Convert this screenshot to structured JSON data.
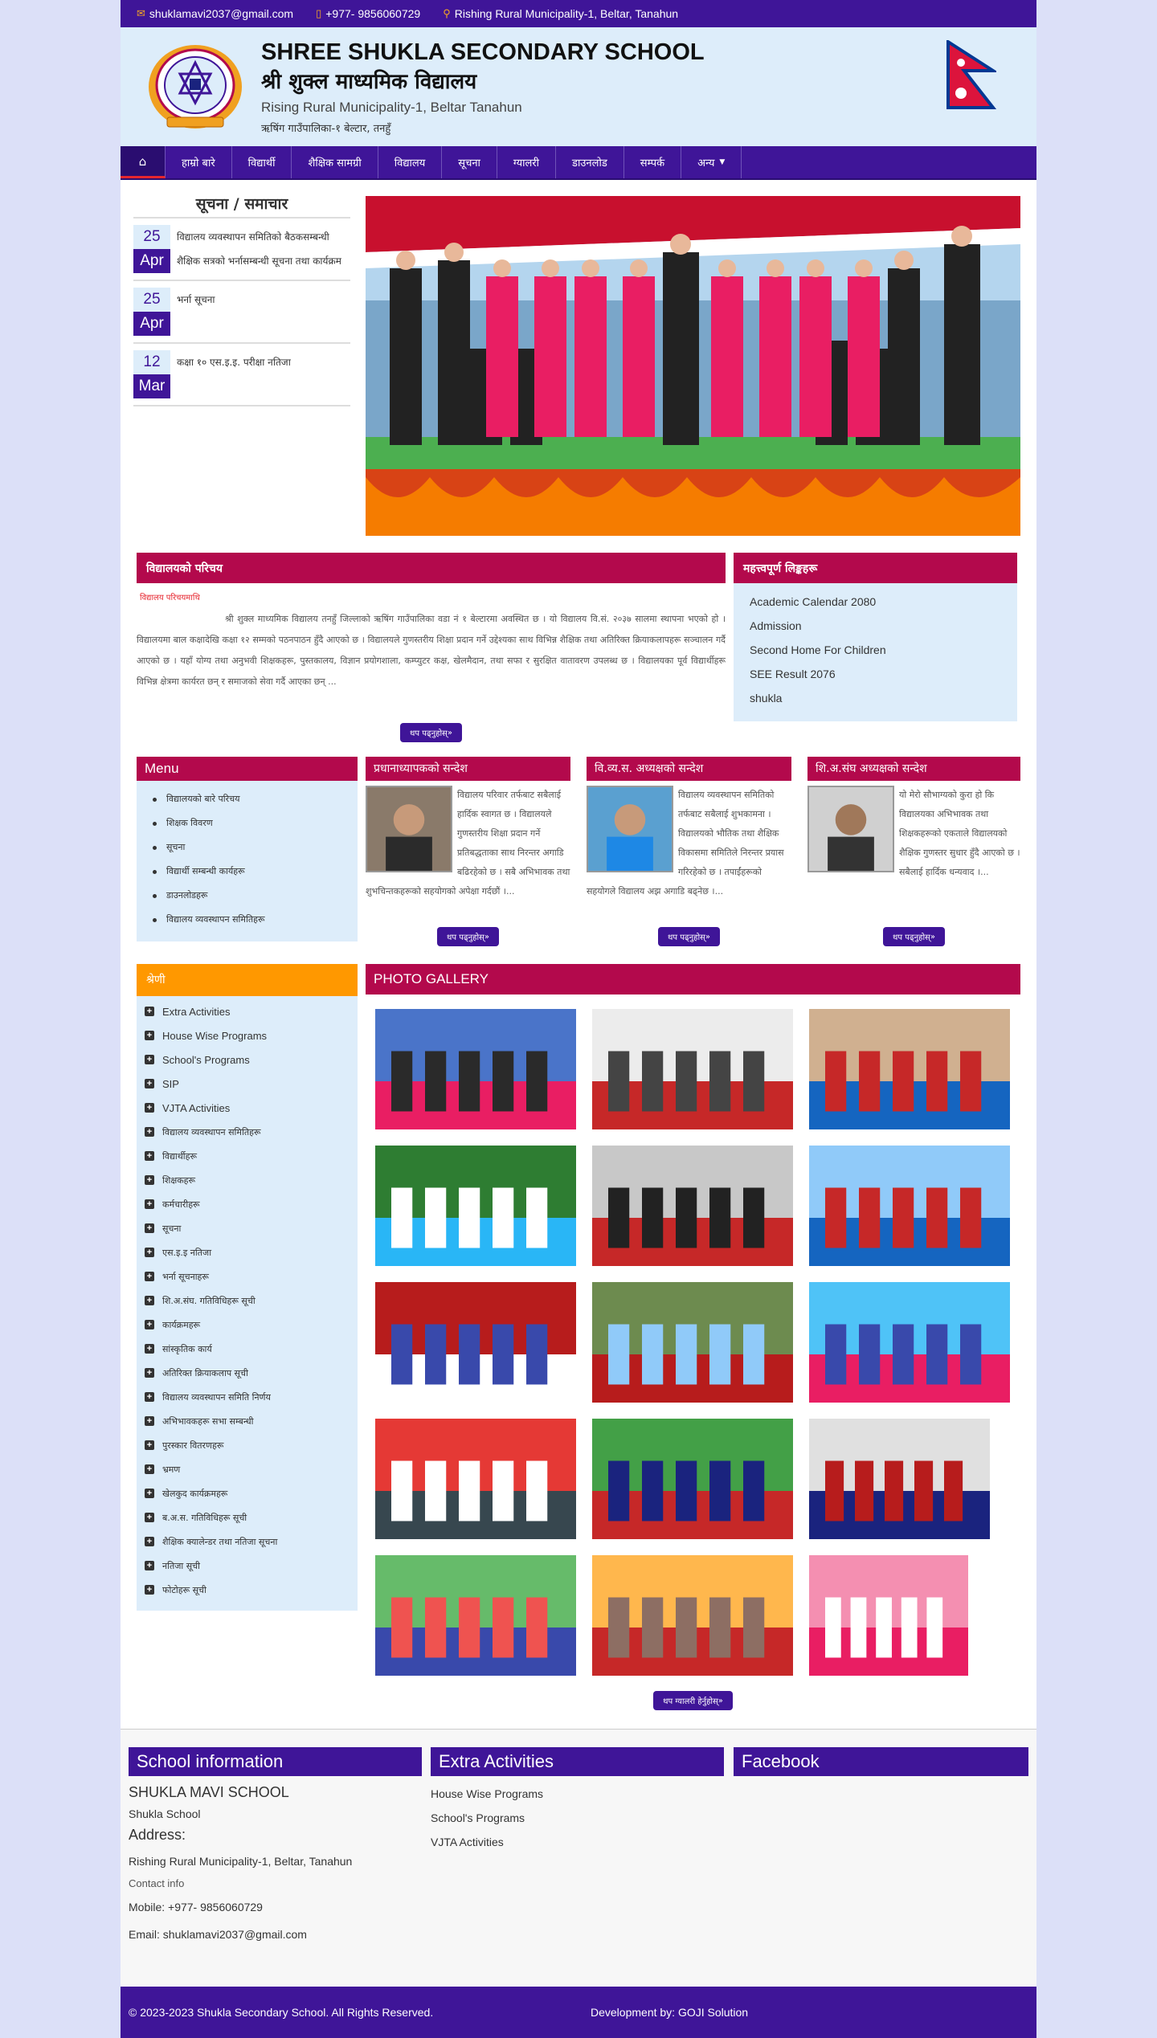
{
  "topbar": {
    "email": "shuklamavi2037@gmail.com",
    "phone": "+977- 9856060729",
    "address": "Rishing Rural Municipality-1, Beltar, Tanahun"
  },
  "header": {
    "title_en": "SHREE SHUKLA SECONDARY SCHOOL",
    "title_np": "श्री शुक्ल माध्यमिक विद्यालय",
    "address_en": "Rising Rural Municipality-1, Beltar Tanahun",
    "address_np": "ऋषिंग गाउँपालिका-१ बेल्टार, तनहुँ"
  },
  "nav": {
    "items": [
      "हाम्रो बारे",
      "विद्यार्थी",
      "शैक्षिक सामग्री",
      "विद्यालय",
      "सूचना",
      "ग्यालरी",
      "डाउनलोड",
      "सम्पर्क",
      "अन्य"
    ]
  },
  "news": {
    "title": "सूचना / समाचार",
    "items": [
      {
        "day": "25",
        "month": "Apr",
        "lines": [
          "विद्यालय व्यवस्थापन समितिको बैठकसम्बन्धी",
          "शैक्षिक सत्रको भर्नासम्बन्धी सूचना तथा कार्यक्रम"
        ]
      },
      {
        "day": "25",
        "month": "Apr",
        "lines": [
          "भर्ना सूचना"
        ]
      },
      {
        "day": "12",
        "month": "Mar",
        "lines": [
          "कक्षा १० एस.इ.इ. परीक्षा नतिजा"
        ]
      }
    ]
  },
  "intro": {
    "title": "विद्यालयको परिचय",
    "subtitle": "विद्यालय परिचयमाथि",
    "para": "श्री शुक्ल माध्यमिक विद्यालय तनहुँ जिल्लाको ऋषिंग गाउँपालिका वडा नं १ बेल्टारमा अवस्थित छ । यो विद्यालय वि.सं. २०३७ सालमा स्थापना भएको हो । विद्यालयमा बाल कक्षादेखि कक्षा १२ सम्मको पठनपाठन हुँदै आएको छ । विद्यालयले गुणस्तरीय शिक्षा प्रदान गर्ने उद्देश्यका साथ विभिन्न शैक्षिक तथा अतिरिक्त क्रियाकलापहरू सञ्चालन गर्दै आएको छ । यहाँ योग्य तथा अनुभवी शिक्षकहरू, पुस्तकालय, विज्ञान प्रयोगशाला, कम्प्युटर कक्ष, खेलमैदान, तथा सफा र सुरक्षित वातावरण उपलब्ध छ । विद्यालयका पूर्व विद्यार्थीहरू विभिन्न क्षेत्रमा कार्यरत छन् र समाजको सेवा गर्दै आएका छन् ...",
    "more": "थप पढ्नुहोस्"
  },
  "important": {
    "title": "महत्त्वपूर्ण लिङ्कहरू",
    "links": [
      "Academic Calendar 2080",
      "Admission",
      "Second Home For Children",
      "SEE Result 2076",
      "shukla"
    ]
  },
  "menu": {
    "title": "Menu",
    "items": [
      "विद्यालयको बारे परिचय",
      "शिक्षक विवरण",
      "सूचना",
      "विद्यार्थी सम्बन्धी कार्यहरू",
      "डाउनलोडहरू",
      "विद्यालय व्यवस्थापन समितिहरू"
    ]
  },
  "cards": [
    {
      "title": "प्रधानाध्यापकको सन्देश",
      "text": "विद्यालय परिवार तर्फबाट सबैलाई हार्दिक स्वागत छ । विद्यालयले गुणस्तरीय शिक्षा प्रदान गर्ने प्रतिबद्धताका साथ निरन्तर अगाडि बढिरहेको छ । सबै अभिभावक तथा शुभचिन्तकहरूको सहयोगको अपेक्षा गर्दछौं ।...",
      "more": "थप पढ्नुहोस्"
    },
    {
      "title": "वि.व्य.स. अध्यक्षको सन्देश",
      "text": "विद्यालय व्यवस्थापन समितिको तर्फबाट सबैलाई शुभकामना । विद्यालयको भौतिक तथा शैक्षिक विकासमा समितिले निरन्तर प्रयास गरिरहेको छ । तपाईंहरूको सहयोगले विद्यालय अझ अगाडि बढ्नेछ ।...",
      "more": "थप पढ्नुहोस्"
    },
    {
      "title": "शि.अ.संघ अध्यक्षको सन्देश",
      "text": "यो मेरो सौभाग्यको कुरा हो कि विद्यालयका अभिभावक तथा शिक्षकहरूको एकताले विद्यालयको शैक्षिक गुणस्तर सुधार हुँदै आएको छ । सबैलाई हार्दिक धन्यवाद ।...",
      "more": "थप पढ्नुहोस्"
    }
  ],
  "categories": {
    "title": "श्रेणी",
    "items": [
      "Extra Activities",
      "House Wise Programs",
      "School's Programs",
      "SIP",
      "VJTA Activities",
      "विद्यालय व्यवस्थापन समितिहरू",
      "विद्यार्थीहरू",
      "शिक्षकहरू",
      "कर्मचारीहरू",
      "सूचना",
      "एस.इ.इ नतिजा",
      "भर्ना सूचनाहरू",
      "शि.अ.संघ. गतिविधिहरू सूची",
      "कार्यक्रमहरू",
      "सांस्कृतिक कार्य",
      "अतिरिक्त क्रियाकलाप सूची",
      "विद्यालय व्यवस्थापन समिति निर्णय",
      "अभिभावकहरू सभा सम्बन्धी",
      "पुरस्कार वितरणहरू",
      "भ्रमण",
      "खेलकुद कार्यक्रमहरू",
      "ब.अ.स. गतिविधिहरू सूची",
      "शैक्षिक क्यालेन्डर तथा नतिजा सूचना",
      "नतिजा सूची",
      "फोटोहरू सूची"
    ]
  },
  "gallery": {
    "title": "PHOTO GALLERY",
    "more": "थप ग्यालरी हेर्नुहोस्"
  },
  "footer": {
    "info_title": "School information",
    "school_name": "SHUKLA MAVI SCHOOL",
    "school_name2": "Shukla School",
    "address_label": "Address:",
    "address": "Rishing Rural Municipality-1, Beltar, Tanahun",
    "contact_label": "Contact info",
    "mobile": "Mobile: +977- 9856060729",
    "email": "Email: shuklamavi2037@gmail.com",
    "extra_title": "Extra Activities",
    "extra_links": [
      "House Wise Programs",
      "School's Programs",
      "VJTA Activities"
    ],
    "fb_title": "Facebook",
    "copyright": "© 2023-2023 Shukla Secondary School. All Rights Reserved.",
    "dev": "Development by: GOJI Solution"
  },
  "colors": {
    "primary": "#3f1598",
    "accent": "#b3094c",
    "orange": "#ff9800",
    "panel": "#ddedfa"
  }
}
